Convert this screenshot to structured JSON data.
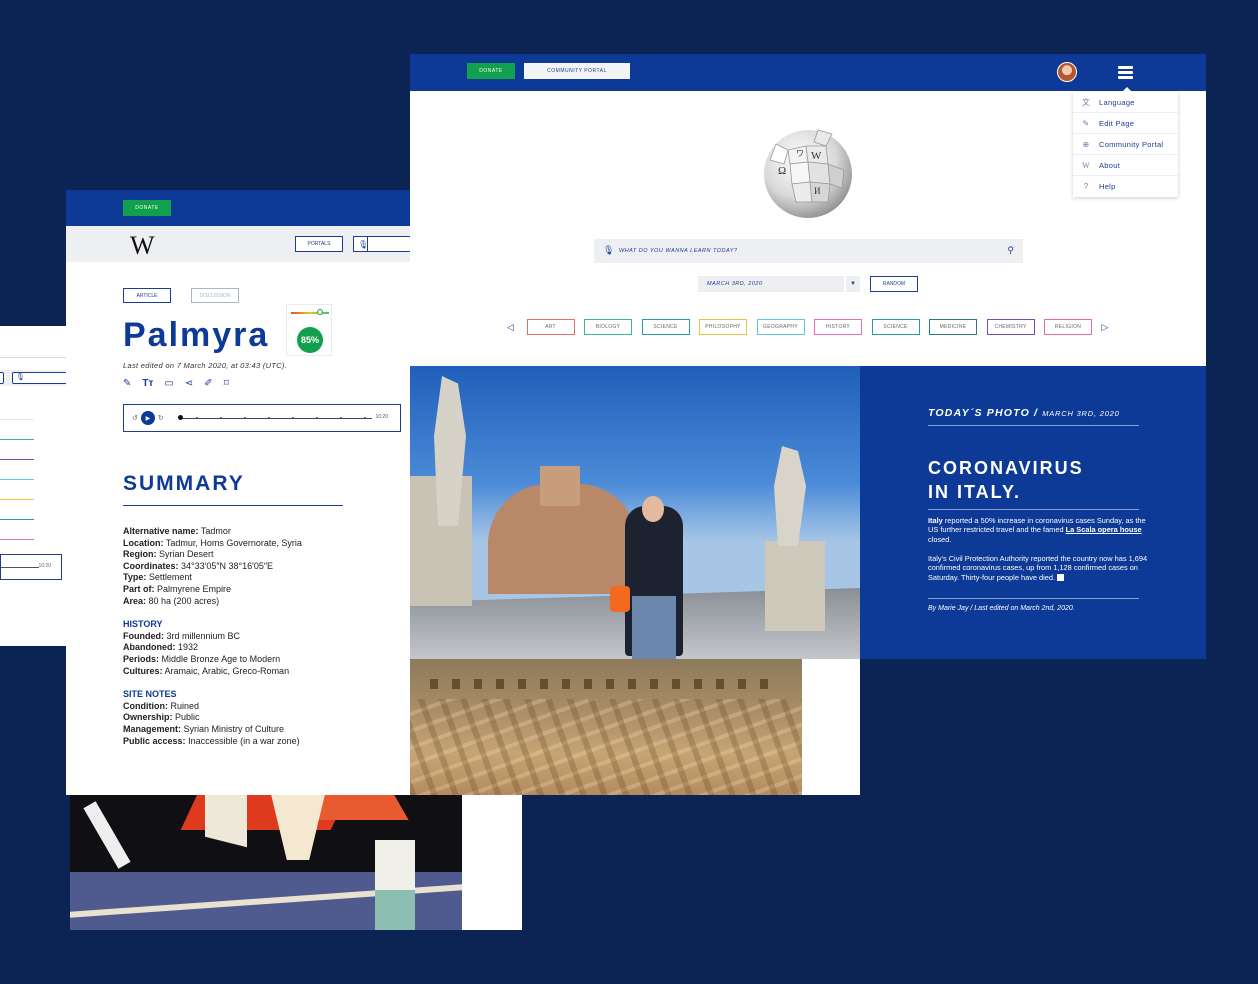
{
  "palmyra": {
    "donate_label": "DONATE",
    "portals_label": "PORTALS",
    "logo_text": "W",
    "tabs": [
      {
        "label": "ARTICLE"
      },
      {
        "label": "DISCUSSION"
      }
    ],
    "title": "Palmyra",
    "score": "85%",
    "edited": "Last edited on 7 March 2020, at 03:43 (UTC).",
    "audio_time": "10:20",
    "summary_heading": "SUMMARY",
    "summary": [
      {
        "k": "Alternative name:",
        "v": "Tadmor"
      },
      {
        "k": "Location:",
        "v": "Tadmur, Homs Governorate, Syria"
      },
      {
        "k": "Region:",
        "v": "Syrian Desert"
      },
      {
        "k": "Coordinates:",
        "v": "34°33′05″N 38°16′05″E"
      },
      {
        "k": "Type:",
        "v": "Settlement"
      },
      {
        "k": "Part of:",
        "v": "Palmyrene Empire"
      },
      {
        "k": "Area:",
        "v": "80 ha (200 acres)"
      }
    ],
    "history_heading": "HISTORY",
    "history": [
      {
        "k": "Founded:",
        "v": "3rd millennium BC"
      },
      {
        "k": "Abandoned:",
        "v": "1932"
      },
      {
        "k": "Periods:",
        "v": "Middle Bronze Age to Modern"
      },
      {
        "k": "Cultures:",
        "v": "Aramaic, Arabic, Greco-Roman"
      }
    ],
    "site_heading": "SITE NOTES",
    "site": [
      {
        "k": "Condition:",
        "v": "Ruined"
      },
      {
        "k": "Ownership:",
        "v": "Public"
      },
      {
        "k": "Management:",
        "v": "Syrian Ministry of Culture"
      },
      {
        "k": "Public access:",
        "v": "Inaccessible (in a war zone)"
      }
    ]
  },
  "third_card": {
    "audio_time": "10:20"
  },
  "main": {
    "donate_label": "DONATE",
    "portal_label": "COMMUNITY PORTAL",
    "menu": [
      {
        "label": "Language",
        "icon": "translate-icon",
        "glyph": "文"
      },
      {
        "label": "Edit Page",
        "icon": "pencil-icon",
        "glyph": "✎"
      },
      {
        "label": "Community Portal",
        "icon": "globe-icon",
        "glyph": "⊕"
      },
      {
        "label": "About",
        "icon": "wikipedia-w-icon",
        "glyph": "W"
      },
      {
        "label": "Help",
        "icon": "help-icon",
        "glyph": "?"
      }
    ],
    "search_placeholder": "WHAT DO YOU WANNA LEARN TODAY?",
    "date_value": "MARCH 3RD, 2020",
    "random_label": "RANDOM",
    "categories": [
      {
        "label": "ART",
        "color": "#e96b6b"
      },
      {
        "label": "BIOLOGY",
        "color": "#3fb68b"
      },
      {
        "label": "SCIENCE",
        "color": "#2c9aa8"
      },
      {
        "label": "PHILOSOPHY",
        "color": "#e8c43a"
      },
      {
        "label": "GEOGRAPHY",
        "color": "#5bc6e8"
      },
      {
        "label": "HISTORY",
        "color": "#e970b7"
      },
      {
        "label": "SCIENCE",
        "color": "#2c9aa8"
      },
      {
        "label": "MEDICINE",
        "color": "#2a7a7d"
      },
      {
        "label": "CHEMISTRY",
        "color": "#7a4bb5"
      },
      {
        "label": "RELIGION",
        "color": "#e967a2"
      }
    ],
    "feature": {
      "kicker": "TODAY´S PHOTO /",
      "kicker_date": "MARCH 3RD, 2020",
      "headline_1": "CORONAVIRUS",
      "headline_2": "IN ITALY.",
      "p1_bold": "Italy",
      "p1_text": " reported a 50% increase in coronavirus cases Sunday, as the US further restricted travel and the famed ",
      "p1_link": "La Scala opera house",
      "p1_end": " closed.",
      "p2": "Italy's Civil Protection Authority reported the country now has 1,694 confirmed coronavirus cases, up from 1,128 confirmed cases on Saturday. Thirty-four people have died.",
      "byline": "By Marie Jay / Last edited on March 2nd, 2020."
    }
  },
  "colors": {
    "background": "#0b2453",
    "brand_blue": "#0d3a96",
    "donate_green": "#11a04c"
  }
}
